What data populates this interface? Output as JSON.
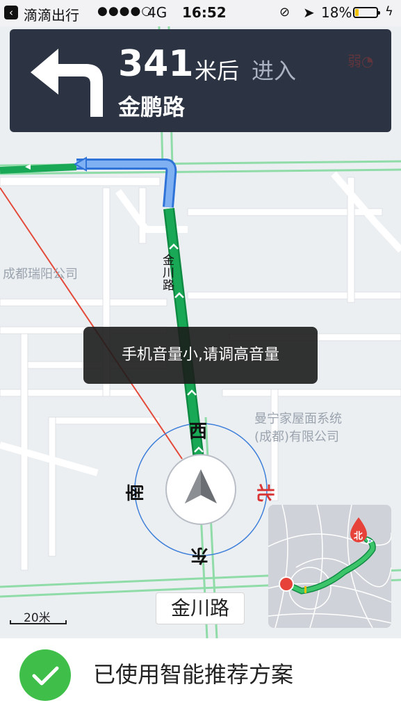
{
  "status_bar": {
    "app_name": "滴滴出行",
    "signal_dots": "●●●●○",
    "network": "4G",
    "time": "16:52",
    "battery_percent": "18%",
    "battery_level": 0.18,
    "battery_color": "#f3c200"
  },
  "nav_card": {
    "distance": "341",
    "unit": "米后",
    "action": "进入",
    "road": "金鹏路",
    "signal_label": "弱",
    "turn_icon": "turn-left-icon",
    "background": "#2c3444"
  },
  "map": {
    "labels": {
      "company_west": "成都瑞阳公司",
      "company_east_line1": "曼宁家屋面系统",
      "company_east_line2": "(成都)有限公司",
      "route_road": "金川路"
    },
    "route_color": "#19a855",
    "compass": {
      "north": "北",
      "south": "南",
      "east": "东",
      "west": "西"
    },
    "current_road": "金川路",
    "scale": "20米",
    "minimap_north": "北"
  },
  "toast": {
    "message": "手机音量小,请调高音量"
  },
  "bottom_bar": {
    "message": "已使用智能推荐方案",
    "accent": "#3fbf4a"
  }
}
